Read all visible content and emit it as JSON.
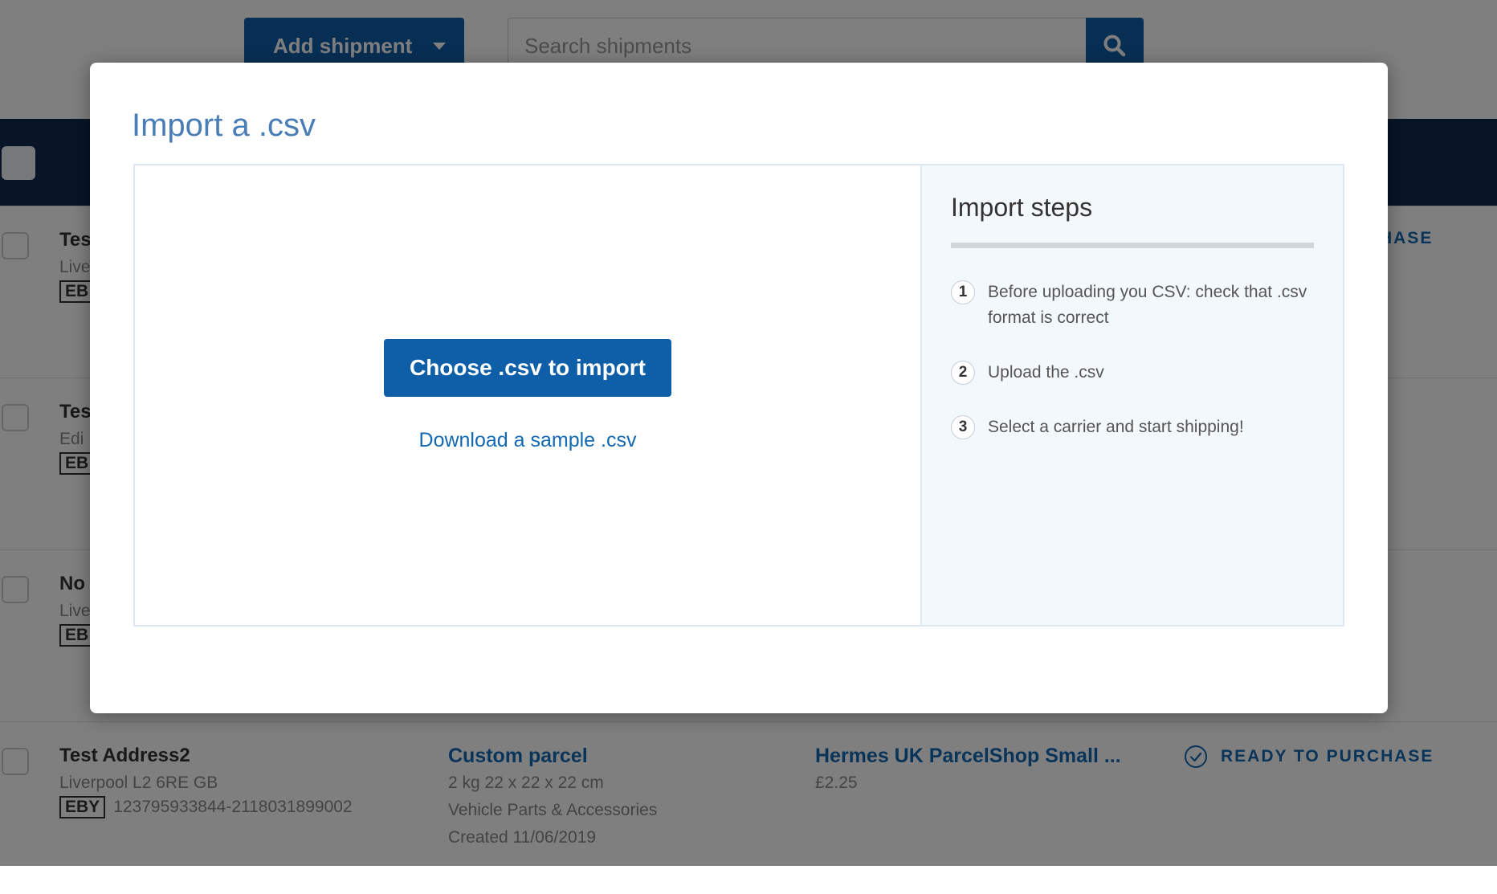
{
  "toolbar": {
    "add_shipment_label": "Add shipment",
    "search_placeholder": "Search shipments"
  },
  "rows": [
    {
      "name": "Tes",
      "location": "Live",
      "badge": "EB",
      "order": "",
      "parcel": "",
      "parcel_lines": [],
      "carrier": "",
      "price": "",
      "status": "HASE"
    },
    {
      "name": "Tes",
      "location": "Edi",
      "badge": "EB",
      "order": "",
      "parcel": "",
      "parcel_lines": [],
      "carrier": "",
      "price": "",
      "status": ""
    },
    {
      "name": "No",
      "location": "Live",
      "badge": "EB",
      "order": "",
      "parcel": "",
      "parcel_lines": [],
      "carrier": "",
      "price": "",
      "status": ""
    },
    {
      "name": "Test Address2",
      "location": "Liverpool L2 6RE GB",
      "badge": "EBY",
      "order": "123795933844-2118031899002",
      "parcel": "Custom parcel",
      "parcel_lines": [
        "2 kg 22 x 22 x 22 cm",
        "Vehicle Parts & Accessories",
        "Created 11/06/2019"
      ],
      "carrier": "Hermes UK ParcelShop Small ...",
      "price": "£2.25",
      "status": "READY TO PURCHASE"
    }
  ],
  "modal": {
    "title": "Import a .csv",
    "choose_button": "Choose .csv to import",
    "sample_link": "Download a sample .csv",
    "steps_title": "Import steps",
    "steps": [
      {
        "num": "1",
        "text": "Before uploading you CSV: check that .csv format is correct"
      },
      {
        "num": "2",
        "text": "Upload the .csv"
      },
      {
        "num": "3",
        "text": "Select a carrier and start shipping!"
      }
    ]
  },
  "colors": {
    "primary": "#0f5fa8",
    "link": "#1268b3",
    "header_bar": "#0f2a4f",
    "title": "#4a7cb5",
    "steps_bg": "#f3f8fc"
  }
}
